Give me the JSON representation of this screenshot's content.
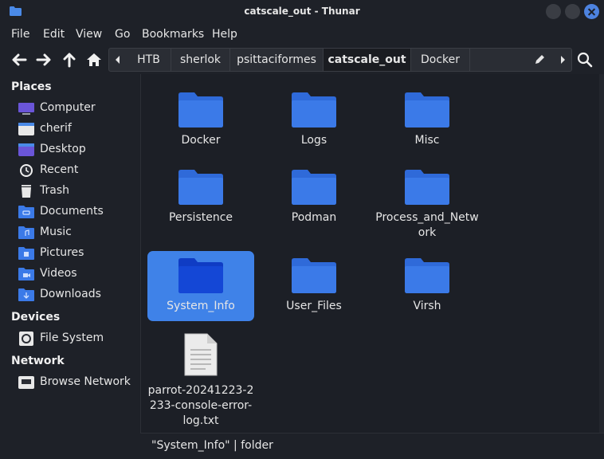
{
  "window": {
    "title": "catscale_out - Thunar"
  },
  "menu": [
    "File",
    "Edit",
    "View",
    "Go",
    "Bookmarks",
    "Help"
  ],
  "path": [
    "HTB",
    "sherlok",
    "psittaciformes",
    "catscale_out",
    "Docker"
  ],
  "sidebar": {
    "places_heading": "Places",
    "places": [
      {
        "label": "Computer",
        "icon": "computer-icon"
      },
      {
        "label": "cherif",
        "icon": "home-folder-icon"
      },
      {
        "label": "Desktop",
        "icon": "desktop-icon"
      },
      {
        "label": "Recent",
        "icon": "recent-icon"
      },
      {
        "label": "Trash",
        "icon": "trash-icon"
      },
      {
        "label": "Documents",
        "icon": "documents-folder-icon"
      },
      {
        "label": "Music",
        "icon": "music-folder-icon"
      },
      {
        "label": "Pictures",
        "icon": "pictures-folder-icon"
      },
      {
        "label": "Videos",
        "icon": "videos-folder-icon"
      },
      {
        "label": "Downloads",
        "icon": "downloads-folder-icon"
      }
    ],
    "devices_heading": "Devices",
    "devices": [
      {
        "label": "File System",
        "icon": "drive-icon"
      }
    ],
    "network_heading": "Network",
    "network": [
      {
        "label": "Browse Network",
        "icon": "network-icon"
      }
    ]
  },
  "files": [
    {
      "name": "Docker",
      "type": "folder"
    },
    {
      "name": "Logs",
      "type": "folder"
    },
    {
      "name": "Misc",
      "type": "folder"
    },
    {
      "name": "Persistence",
      "type": "folder"
    },
    {
      "name": "Podman",
      "type": "folder"
    },
    {
      "name": "Process_and_Network",
      "name_lines": [
        "Process_and_Netw",
        "ork"
      ],
      "type": "folder"
    },
    {
      "name": "System_Info",
      "type": "folder",
      "selected": true
    },
    {
      "name": "User_Files",
      "type": "folder"
    },
    {
      "name": "Virsh",
      "type": "folder"
    },
    {
      "name": "parrot-20241223-2233-console-error-log.txt",
      "name_lines": [
        "parrot-20241223-2",
        "233-console-error-",
        "log.txt"
      ],
      "type": "text-file"
    }
  ],
  "status": {
    "text": "\"System_Info\" | folder"
  },
  "colors": {
    "accent": "#3f82e8",
    "folder": "#3b7ae8",
    "folder_selected": "#1447d6",
    "window_bg": "#1e2128",
    "pane_bg": "#1c1f26"
  }
}
